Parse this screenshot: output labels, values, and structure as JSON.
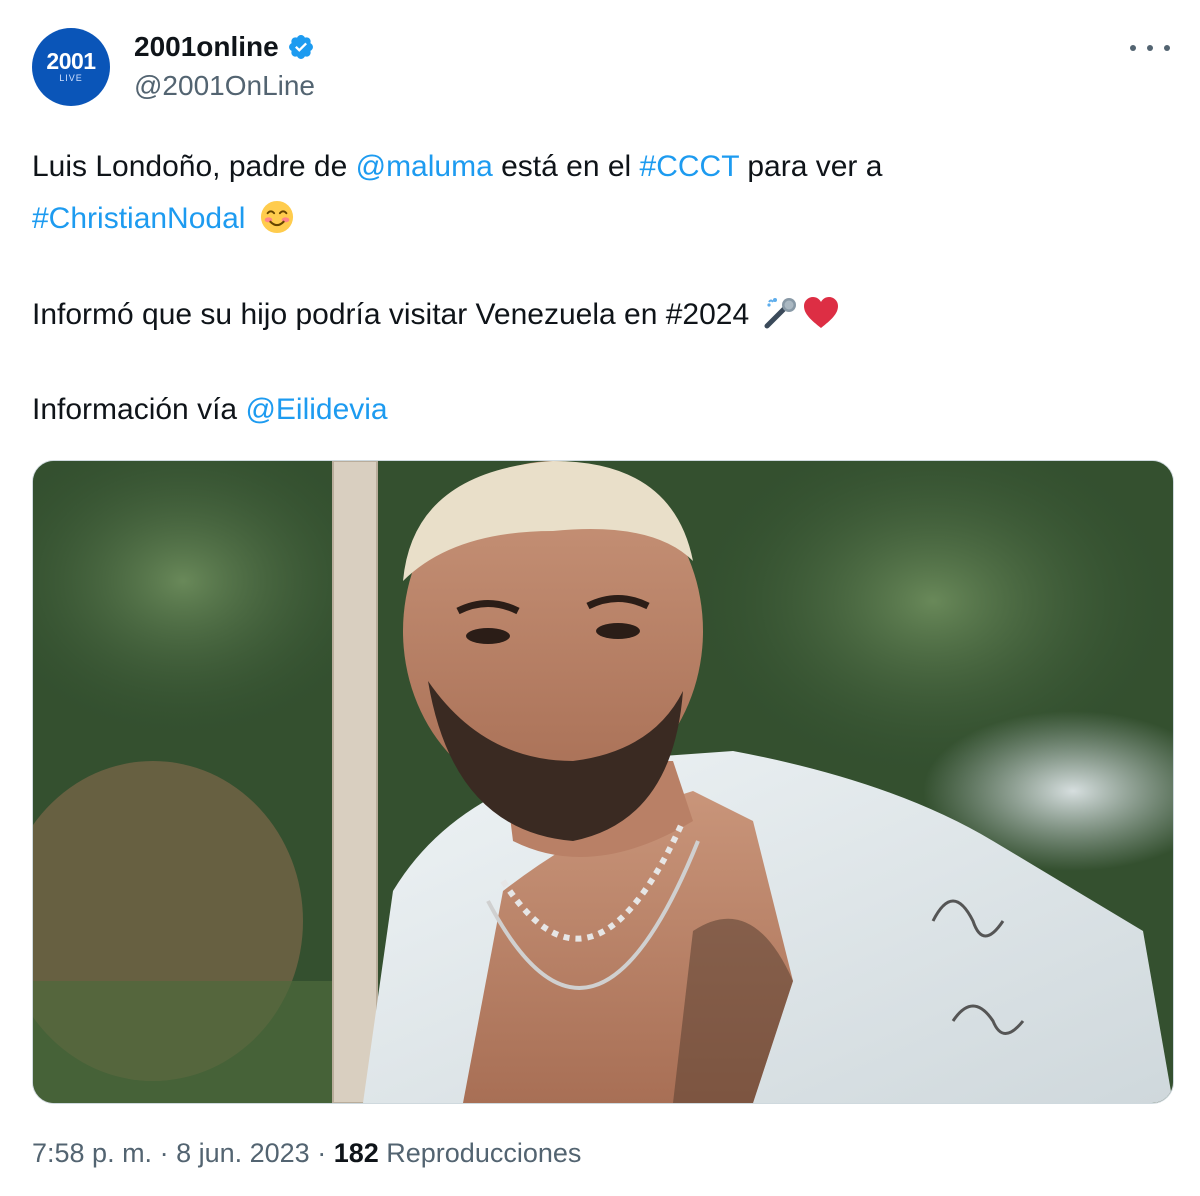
{
  "author": {
    "avatar_text": "2001",
    "avatar_subtext": "LIVE",
    "display_name": "2001online",
    "handle": "@2001OnLine",
    "verified": true
  },
  "tweet": {
    "line1": {
      "t1": "Luis Londoño, padre de ",
      "mention1": "@maluma",
      "t2": " está en el ",
      "hashtag1": "#CCCT",
      "t3": " para ver a"
    },
    "line2": {
      "hashtag2": "#ChristianNodal"
    },
    "line3": {
      "t1": "Informó que su hijo podría visitar Venezuela en #2024 "
    },
    "line4": {
      "t1": "Información vía ",
      "mention2": "@Eilidevia"
    }
  },
  "media": {
    "description": "photo"
  },
  "footer": {
    "time": "7:58 p. m.",
    "sep1": " · ",
    "date": "8 jun. 2023",
    "sep2": " · ",
    "views_count": "182",
    "views_label": " Reproducciones"
  },
  "colors": {
    "link": "#1d9bf0",
    "verified": "#1d9bf0",
    "avatar_bg": "#0a55b8",
    "secondary_text": "#536471"
  },
  "icons": [
    "verified-badge-icon",
    "more-options-icon",
    "smiling-face-emoji",
    "microphone-emoji",
    "red-heart-emoji"
  ]
}
